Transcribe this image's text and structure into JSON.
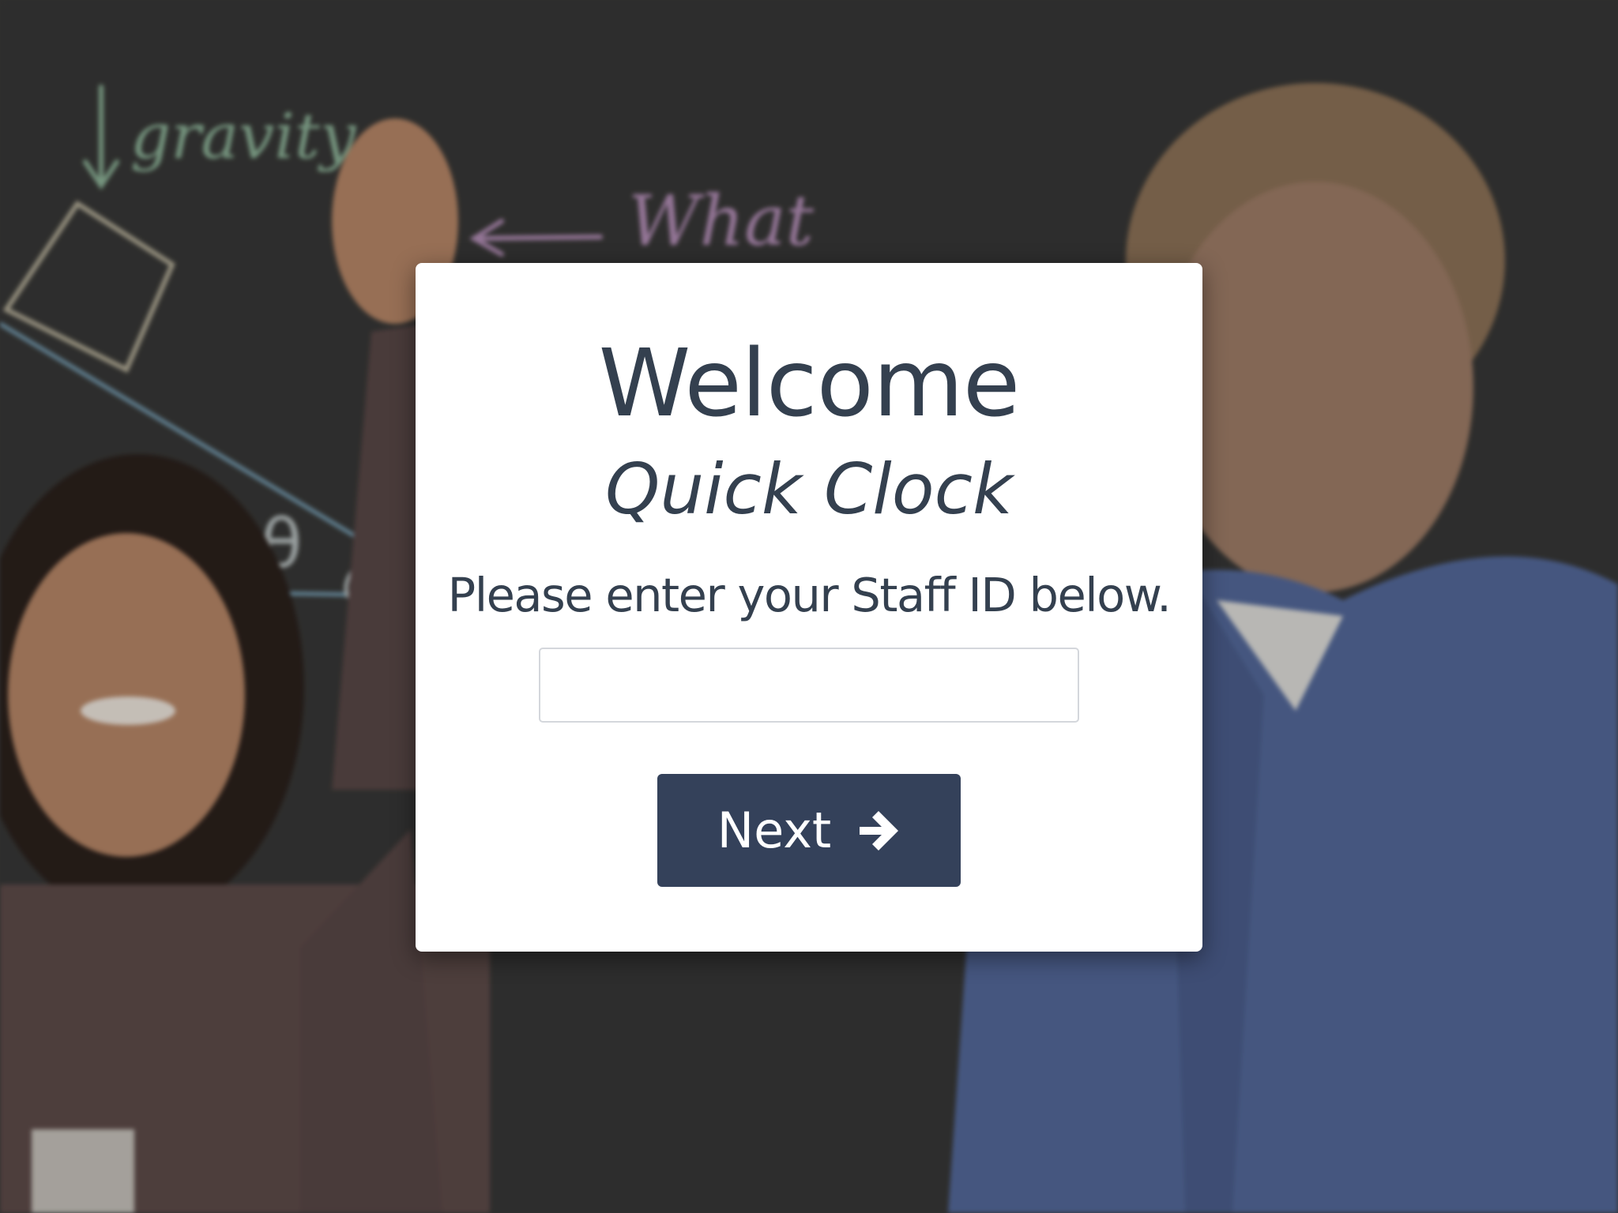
{
  "colors": {
    "text": "#34404f",
    "button_bg": "#34415a",
    "button_text": "#ffffff",
    "card_bg": "#ffffff",
    "input_border": "#d4d7dc"
  },
  "background": {
    "chalk_words": [
      "gravity",
      "What"
    ],
    "chalk_symbol": "θ"
  },
  "login": {
    "title": "Welcome",
    "subtitle": "Quick Clock",
    "prompt": "Please enter your Staff ID below.",
    "staff_id_value": "",
    "next_label": "Next",
    "next_icon": "arrow-right-icon"
  }
}
